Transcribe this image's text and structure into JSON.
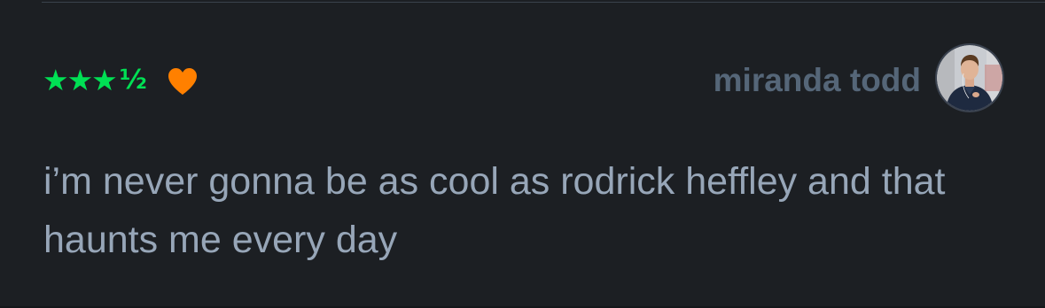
{
  "review": {
    "rating_stars": "★★★",
    "rating_half": "½",
    "liked": true,
    "author": "miranda todd",
    "text": "i’m never gonna be as cool as rodrick heffley and that haunts me every day"
  },
  "colors": {
    "background": "#1c1f23",
    "star": "#00e054",
    "heart": "#ff8000",
    "author": "#556678",
    "text": "#97a6b8"
  },
  "icons": {
    "like": "heart-icon",
    "avatar": "avatar"
  }
}
